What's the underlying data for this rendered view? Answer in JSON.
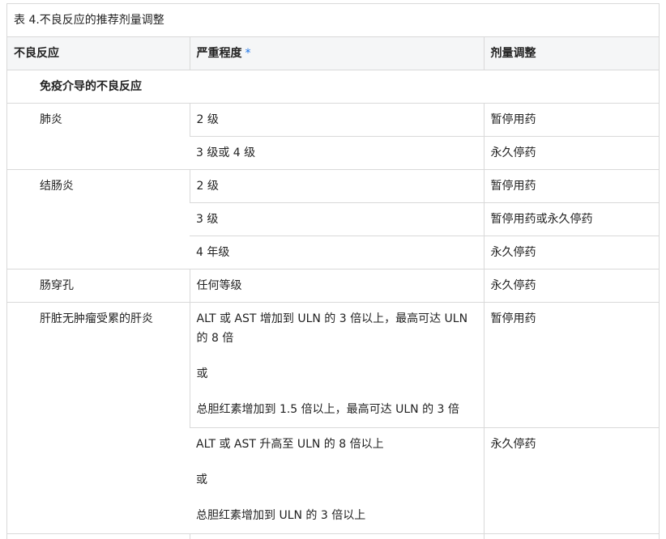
{
  "caption": "表 4.不良反应的推荐剂量调整",
  "headers": {
    "reaction": "不良反应",
    "severity": "严重程度",
    "severity_mark": "*",
    "adjustment": "剂量调整"
  },
  "section_title": "免疫介导的不良反应",
  "rows": {
    "pneumonitis": {
      "name": "肺炎",
      "r1_severity": "2 级",
      "r1_adjust": "暂停用药",
      "r2_severity": "3 级或 4 级",
      "r2_adjust": "永久停药"
    },
    "colitis": {
      "name": "结肠炎",
      "r1_severity": "2 级",
      "r1_adjust": "暂停用药",
      "r2_severity": "3 级",
      "r2_adjust": "暂停用药或永久停药",
      "r3_severity": "4 年级",
      "r3_adjust": "永久停药"
    },
    "perforation": {
      "name": "肠穿孔",
      "severity": "任何等级",
      "adjust": "永久停药"
    },
    "hepatitis": {
      "name": "肝脏无肿瘤受累的肝炎",
      "r1_line1": "ALT 或 AST 增加到 ULN 的 3 倍以上，最高可达 ULN 的 8 倍",
      "r1_or": "或",
      "r1_line2": "总胆红素增加到 1.5 倍以上，最高可达 ULN 的 3 倍",
      "r1_adjust": "暂停用药",
      "r2_line1": "ALT 或 AST 升高至 ULN 的 8 倍以上",
      "r2_or": "或",
      "r2_line2": "总胆红素增加到 ULN 的 3 倍以上",
      "r2_adjust": "永久停药"
    }
  }
}
